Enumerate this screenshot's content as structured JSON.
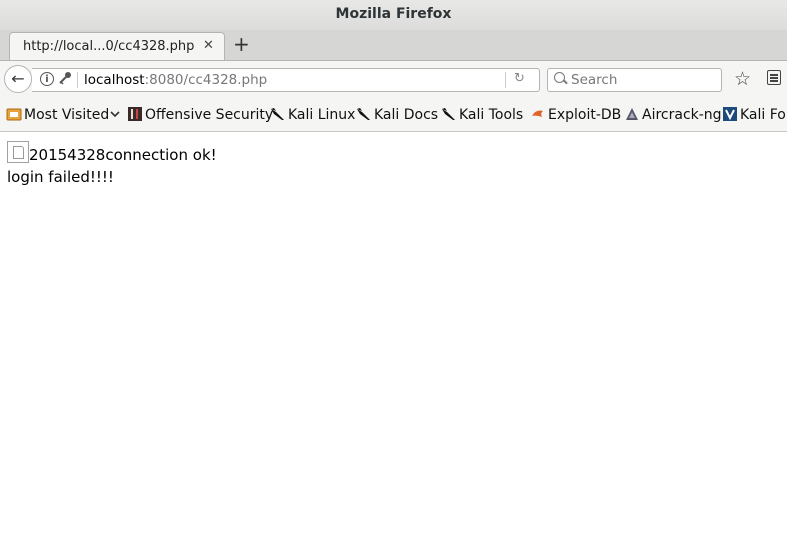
{
  "window": {
    "title": "Mozilla Firefox"
  },
  "tab": {
    "title": "http://local...0/cc4328.php",
    "close_glyph": "✕"
  },
  "new_tab_glyph": "+",
  "navbar": {
    "back_glyph": "←",
    "url_host": "localhost",
    "url_rest": ":8080/cc4328.php",
    "reload_glyph": "↻",
    "search_placeholder": "Search",
    "bookmark_star_glyph": "☆"
  },
  "bookmarks": [
    {
      "label": "Most Visited",
      "icon": "folder-icon",
      "dropdown": true
    },
    {
      "label": "Offensive Security",
      "icon": "offsec-icon"
    },
    {
      "label": "Kali Linux",
      "icon": "kali-dragon-icon"
    },
    {
      "label": "Kali Docs",
      "icon": "kali-dragon-icon"
    },
    {
      "label": "Kali Tools",
      "icon": "kali-dragon-icon"
    },
    {
      "label": "Exploit-DB",
      "icon": "exploit-db-icon"
    },
    {
      "label": "Aircrack-ng",
      "icon": "aircrack-icon"
    },
    {
      "label": "Kali For",
      "icon": "kali-forums-icon"
    }
  ],
  "page": {
    "line1": "20154328connection ok!",
    "line2": "login failed!!!!"
  },
  "colors": {
    "tab_bg": "#f5f5f4",
    "toolbar_bg": "#f5f5f4",
    "url_path": "#777777"
  }
}
